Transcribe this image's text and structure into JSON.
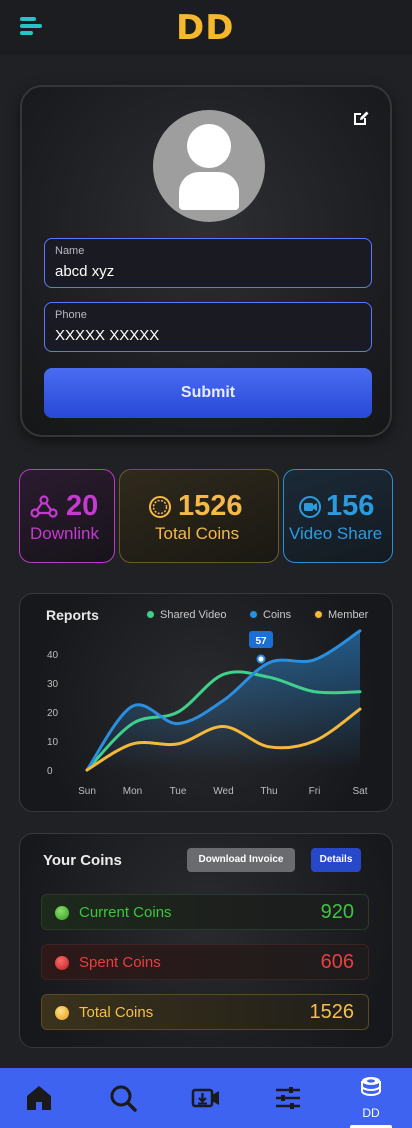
{
  "header": {
    "logo": "DD",
    "menu_icon": "hamburger-menu-icon"
  },
  "profile": {
    "avatar_icon": "user-silhouette-icon",
    "edit_icon": "edit-pencil-icon",
    "name_label": "Name",
    "name_value": "abcd xyz",
    "phone_label": "Phone",
    "phone_value": "XXXXX XXXXX",
    "submit_label": "Submit"
  },
  "stats": [
    {
      "icon": "downlink-network-icon",
      "value": "20",
      "label": "Downlink",
      "color": "#c53ad0"
    },
    {
      "icon": "coin-icon",
      "value": "1526",
      "label": "Total Coins",
      "color": "#f5b84a"
    },
    {
      "icon": "video-share-icon",
      "value": "156",
      "label": "Video Share",
      "color": "#2b9be0"
    }
  ],
  "reports": {
    "title": "Reports",
    "legend": [
      {
        "label": "Shared Video",
        "color": "#3fd08c"
      },
      {
        "label": "Coins",
        "color": "#2b8fe0"
      },
      {
        "label": "Member",
        "color": "#f5b83a"
      }
    ],
    "tooltip": "57"
  },
  "chart_data": {
    "type": "line",
    "title": "Reports",
    "categories": [
      "Sun",
      "Mon",
      "Tue",
      "Wed",
      "Thu",
      "Fri",
      "Sat"
    ],
    "yticks": [
      "0",
      "10",
      "20",
      "30",
      "40"
    ],
    "ylim": [
      0,
      50
    ],
    "series": [
      {
        "name": "Shared Video",
        "color": "#3fd08c",
        "values": [
          0,
          16,
          20,
          33,
          32,
          27,
          27
        ]
      },
      {
        "name": "Coins",
        "color": "#2b8fe0",
        "values": [
          0,
          22,
          16,
          24,
          37,
          38,
          48
        ]
      },
      {
        "name": "Member",
        "color": "#f5b83a",
        "values": [
          0,
          9,
          9,
          15,
          8,
          10,
          21
        ]
      }
    ],
    "highlight": {
      "series": "Coins",
      "category": "Thu",
      "label": "57"
    },
    "grid": false,
    "legend_position": "top-right"
  },
  "coins": {
    "title": "Your Coins",
    "download_label": "Download Invoice",
    "details_label": "Details",
    "rows": [
      {
        "label": "Current Coins",
        "value": "920",
        "color": "#3ec43e"
      },
      {
        "label": "Spent Coins",
        "value": "606",
        "color": "#e5403f"
      },
      {
        "label": "Total Coins",
        "value": "1526",
        "color": "#f5c04a"
      }
    ]
  },
  "nav": {
    "items": [
      {
        "icon": "home-icon"
      },
      {
        "icon": "search-icon"
      },
      {
        "icon": "video-download-icon"
      },
      {
        "icon": "sliders-icon"
      },
      {
        "icon": "coins-stack-icon",
        "label": "DD"
      }
    ]
  }
}
